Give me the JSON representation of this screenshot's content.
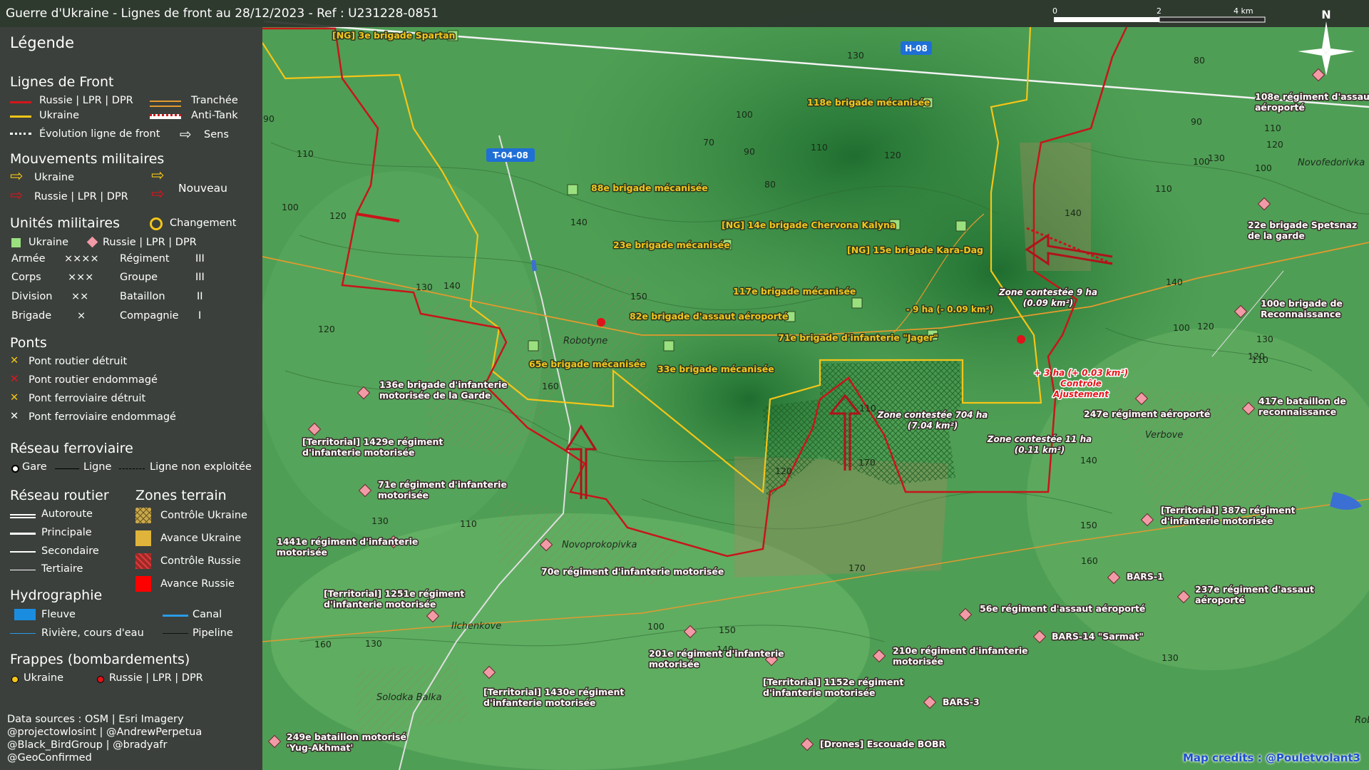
{
  "title": "Guerre d'Ukraine - Lignes de front au 28/12/2023 - Ref : U231228-0851",
  "colors": {
    "russia": "#d4161c",
    "ukraine": "#f5c518",
    "trench": "#e39a2e",
    "legend_bg": "#3a3a3a"
  },
  "scale": {
    "ticks": [
      "0",
      "2",
      "4 km"
    ]
  },
  "north": "N",
  "legend": {
    "title": "Légende",
    "front_lines": {
      "heading": "Lignes de Front",
      "russia": "Russie | LPR | DPR",
      "ukraine": "Ukraine",
      "trench": "Tranchée",
      "antitank": "Anti-Tank",
      "evolution": "Évolution ligne de front",
      "direction": "Sens"
    },
    "movements": {
      "heading": "Mouvements militaires",
      "ukraine": "Ukraine",
      "russia": "Russie | LPR | DPR",
      "new": "Nouveau"
    },
    "units": {
      "heading": "Unités militaires",
      "change": "Changement",
      "ukraine": "Ukraine",
      "russia": "Russie | LPR | DPR",
      "rows": [
        {
          "a": "Armée",
          "as": "××××",
          "b": "Régiment",
          "bs": "III"
        },
        {
          "a": "Corps",
          "as": "×××",
          "b": "Groupe",
          "bs": "III"
        },
        {
          "a": "Division",
          "as": "××",
          "b": "Bataillon",
          "bs": "II"
        },
        {
          "a": "Brigade",
          "as": "×",
          "b": "Compagnie",
          "bs": "I"
        }
      ]
    },
    "bridges": {
      "heading": "Ponts",
      "items": [
        "Pont routier détruit",
        "Pont routier endommagé",
        "Pont ferroviaire détruit",
        "Pont ferroviaire endommagé"
      ]
    },
    "railway": {
      "heading": "Réseau ferroviaire",
      "station": "Gare",
      "line": "Ligne",
      "unused": "Ligne non exploitée"
    },
    "roads": {
      "heading": "Réseau routier",
      "items": [
        "Autoroute",
        "Principale",
        "Secondaire",
        "Tertiaire"
      ]
    },
    "terrain": {
      "heading": "Zones terrain",
      "items": [
        "Contrôle Ukraine",
        "Avance Ukraine",
        "Contrôle Russie",
        "Avance Russie"
      ]
    },
    "hydro": {
      "heading": "Hydrographie",
      "river_big": "Fleuve",
      "canal": "Canal",
      "river": "Rivière, cours d'eau",
      "pipeline": "Pipeline"
    },
    "strikes": {
      "heading": "Frappes (bombardements)",
      "ukraine": "Ukraine",
      "russia": "Russie | LPR | DPR"
    },
    "sources": [
      "Data sources : OSM | Esri Imagery",
      "@projectowlosint | @AndrewPerpetua",
      "@Black_BirdGroup | @bradyafr",
      "@GeoConfirmed"
    ]
  },
  "map_credits": "Map credits : @Pouletvolant3",
  "road_badges": [
    "H-08",
    "T-04-08"
  ],
  "towns": [
    "Robotyne",
    "Novoprokopivka",
    "Ilchenkove",
    "Solodka Balka",
    "Verbove",
    "Novofedorivka",
    "Rob"
  ],
  "ukraine_units": [
    "[NG] 3e brigade Spartan",
    "118e brigade mécanisée",
    "88e brigade mécanisée",
    "[NG] 14e brigade Chervona Kalyna",
    "23e brigade mécanisée",
    "[NG] 15e brigade Kara-Dag",
    "117e brigade mécanisée",
    "82e brigade d'assaut aéroporté",
    "71e brigade d'infanterie \"Jager\"",
    "65e brigade mécanisée",
    "33e brigade mécanisée"
  ],
  "russia_units": [
    "108e régiment d'assaut aéroporté",
    "22e brigade Spetsnaz de la garde",
    "100e brigade de Reconnaissance",
    "417e bataillon de reconnaissance",
    "247e régiment aéroporté",
    "136e brigade d'infanterie motorisée de la Garde",
    "[Territorial] 1429e régiment d'infanterie motorisée",
    "71e régiment d'infanterie motorisée",
    "1441e régiment d'infanterie motorisée",
    "70e régiment d'infanterie motorisée",
    "[Territorial] 1251e régiment d'infanterie motorisée",
    "201e régiment d'infanterie motorisée",
    "[Territorial] 1430e régiment d'infanterie motorisée",
    "[Territorial] 1152e régiment d'infanterie motorisée",
    "210e régiment d'infanterie motorisée",
    "56e régiment d'assaut aéroporté",
    "BARS-14 \"Sarmat\"",
    "BARS-1",
    "237e régiment d'assaut aéroporté",
    "[Territorial] 387e régiment d'infanterie motorisée",
    "BARS-3",
    "[Drones] Escouade BOBR",
    "249e bataillon motorisé 'Yug-Akhmat'"
  ],
  "zones": [
    "Zone contestée 9 ha (0.09 km²)",
    "- 9 ha (- 0.09 km²)",
    "Zone contestée 704 ha (7.04 km²)",
    "Zone contestée 11 ha (0.11 km²)",
    "+ 3 ha (+ 0.03 km²) Contrôle Ajustement"
  ],
  "contours": [
    "130",
    "100",
    "70",
    "90",
    "110",
    "120",
    "80",
    "140",
    "150",
    "160",
    "170",
    "90",
    "110",
    "100",
    "120",
    "130",
    "140",
    "120",
    "130",
    "110",
    "100",
    "150",
    "160",
    "130",
    "140",
    "120",
    "110",
    "170",
    "80",
    "90",
    "100",
    "110",
    "130",
    "140",
    "100",
    "110",
    "130",
    "120",
    "140",
    "150",
    "160",
    "130",
    "120",
    "140",
    "100",
    "110",
    "120"
  ]
}
